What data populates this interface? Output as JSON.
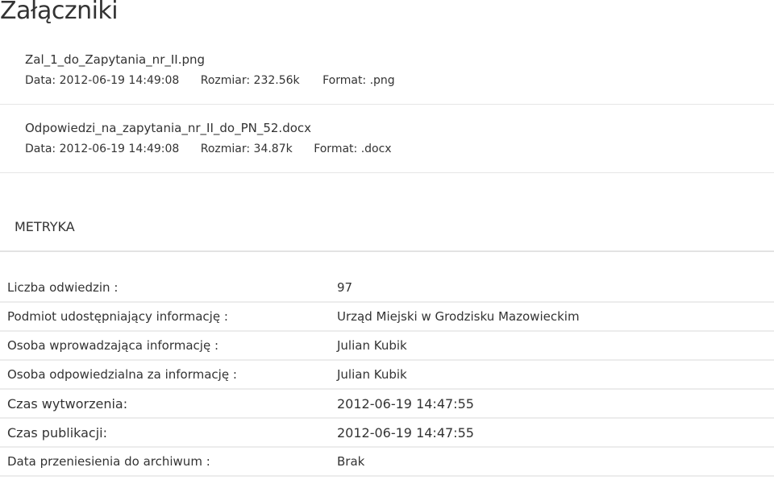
{
  "page": {
    "title": "Załączniki"
  },
  "attachments": [
    {
      "name": "Zal_1_do_Zapytania_nr_II.png",
      "date_label": "Data: 2012-06-19 14:49:08",
      "size_label": "Rozmiar: 232.56k",
      "format_label": "Format: .png"
    },
    {
      "name": "Odpowiedzi_na_zapytania_nr_II_do_PN_52.docx",
      "date_label": "Data: 2012-06-19 14:49:08",
      "size_label": "Rozmiar: 34.87k",
      "format_label": "Format: .docx"
    }
  ],
  "metryka": {
    "title": "METRYKA",
    "rows": [
      {
        "label": "Liczba odwiedzin :",
        "value": "97"
      },
      {
        "label": "Podmiot udostępniający informację :",
        "value": "Urząd Miejski w Grodzisku Mazowieckim"
      },
      {
        "label": "Osoba wprowadzająca informację :",
        "value": "Julian Kubik"
      },
      {
        "label": "Osoba odpowiedzialna za informację :",
        "value": "Julian Kubik"
      },
      {
        "label": "Czas wytworzenia:",
        "value": "2012-06-19 14:47:55"
      },
      {
        "label": "Czas publikacji:",
        "value": "2012-06-19 14:47:55"
      },
      {
        "label": "Data przeniesienia do archiwum :",
        "value": "Brak"
      }
    ]
  }
}
